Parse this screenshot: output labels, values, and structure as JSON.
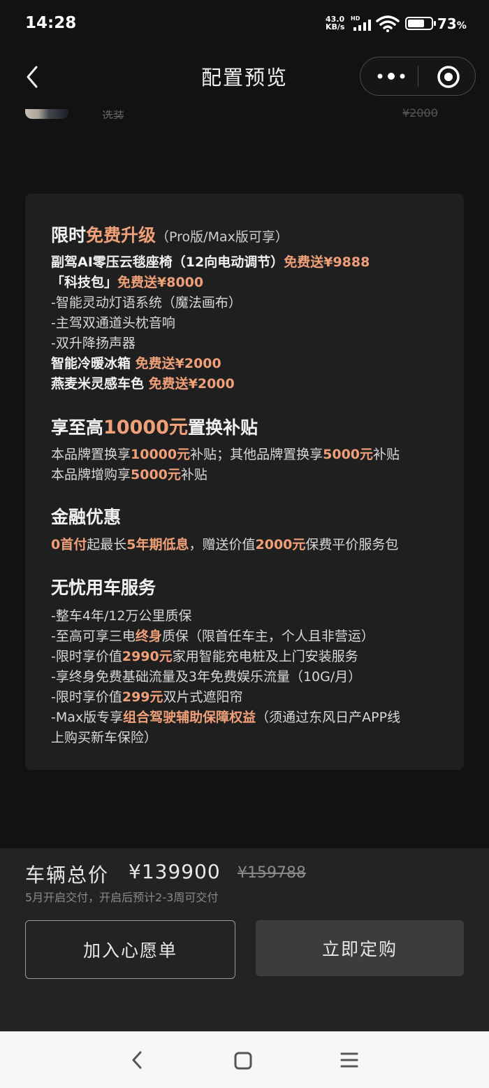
{
  "status_bar": {
    "time": "14:28",
    "net_speed_value": "43.0",
    "net_speed_unit": "KB/s",
    "hd": "HD",
    "battery": "73",
    "battery_unit": "%",
    "battery_level": 0.73
  },
  "header": {
    "title": "配置预览"
  },
  "peek_row": {
    "text": "选装",
    "price": "¥2000"
  },
  "card": {
    "upgrade": {
      "title_prefix": "限时",
      "title_hl": "免费升级",
      "title_note": "（Pro版/Max版可享）",
      "seat": "副驾AI零压云毯座椅（12向电动调节）",
      "seat_gift": "免费送¥9888",
      "tech_pack": "「科技包」",
      "tech_gift": "免费送¥8000",
      "tech_items": [
        "-智能灵动灯语系统（魔法画布）",
        "-主驾双通道头枕音响",
        "-双升降扬声器"
      ],
      "fridge": "智能冷暖冰箱",
      "fridge_gift": "免费送¥2000",
      "color": "燕麦米灵感车色",
      "color_gift": "免费送¥2000"
    },
    "trade_in": {
      "title_prefix": "享至高",
      "title_hl": "10000元",
      "title_suffix": "置换补贴",
      "line1_a": "本品牌置换享",
      "line1_b": "10000元",
      "line1_c": "补贴；其他品牌置换享",
      "line1_d": "5000元",
      "line1_e": "补贴",
      "line2_a": "本品牌增购享",
      "line2_b": "5000元",
      "line2_c": "补贴"
    },
    "finance": {
      "title": "金融优惠",
      "a": "0首付",
      "b": "起最长",
      "c": "5年期低息",
      "d": "，赠送价值",
      "e": "2000元",
      "f": "保费平价服务包"
    },
    "service": {
      "title": "无忧用车服务",
      "l1": "-整车4年/12万公里质保",
      "l2_a": "-至高可享三电",
      "l2_b": "终身",
      "l2_c": "质保（限首任车主，个人且非营运）",
      "l3_a": "-限时享价值",
      "l3_b": "2990元",
      "l3_c": "家用智能充电桩及上门安装服务",
      "l4": "-享终身免费基础流量及3年免费娱乐流量（10G/月）",
      "l5_a": "-限时享价值",
      "l5_b": "299元",
      "l5_c": "双片式遮阳帘",
      "l6_a": "-Max版专享",
      "l6_b": "组合驾驶辅助保障权益",
      "l6_c": "（须通过东风日产APP线",
      "l7": "上购买新车保险）"
    }
  },
  "footer": {
    "total_label": "车辆总价",
    "total_price": "¥139900",
    "original_price": "¥159788",
    "delivery": "5月开启交付，开启后预计2-3周可交付",
    "wish_button": "加入心愿单",
    "buy_button": "立即定购"
  },
  "colors": {
    "background": "#121212",
    "card": "#1f1f1f",
    "highlight": "#f0a078",
    "buy_button": "#3c3c3c"
  }
}
